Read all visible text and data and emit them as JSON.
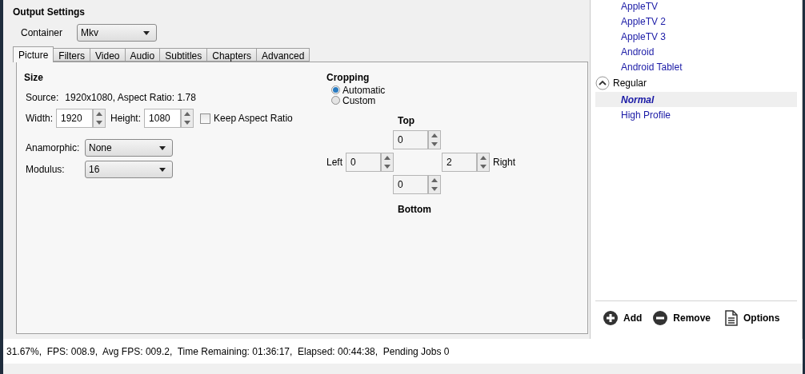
{
  "output_settings": {
    "title": "Output Settings",
    "container_label": "Container",
    "container_value": "Mkv"
  },
  "tabs": [
    {
      "label": "Picture",
      "selected": true
    },
    {
      "label": "Filters",
      "selected": false
    },
    {
      "label": "Video",
      "selected": false
    },
    {
      "label": "Audio",
      "selected": false
    },
    {
      "label": "Subtitles",
      "selected": false
    },
    {
      "label": "Chapters",
      "selected": false
    },
    {
      "label": "Advanced",
      "selected": false
    }
  ],
  "size": {
    "title": "Size",
    "source_label": "Source:",
    "source_value": "1920x1080, Aspect Ratio: 1.78",
    "width_label": "Width:",
    "width_value": "1920",
    "height_label": "Height:",
    "height_value": "1080",
    "keep_aspect": {
      "label": "Keep Aspect Ratio",
      "checked": false
    },
    "anamorphic_label": "Anamorphic:",
    "anamorphic_value": "None",
    "modulus_label": "Modulus:",
    "modulus_value": "16"
  },
  "cropping": {
    "title": "Cropping",
    "modes": [
      {
        "label": "Automatic",
        "selected": true
      },
      {
        "label": "Custom",
        "selected": false
      }
    ],
    "top_label": "Top",
    "top_value": "0",
    "left_label": "Left",
    "left_value": "0",
    "right_value": "2",
    "right_label": "Right",
    "bottom_value": "0",
    "bottom_label": "Bottom"
  },
  "presets": [
    {
      "kind": "preset",
      "label": "AppleTV",
      "selected": false
    },
    {
      "kind": "preset",
      "label": "AppleTV 2",
      "selected": false
    },
    {
      "kind": "preset",
      "label": "AppleTV 3",
      "selected": false
    },
    {
      "kind": "preset",
      "label": "Android",
      "selected": false
    },
    {
      "kind": "preset",
      "label": "Android Tablet",
      "selected": false
    },
    {
      "kind": "group",
      "label": "Regular",
      "expanded": true,
      "children": [
        {
          "label": "Normal",
          "selected": true
        },
        {
          "label": "High Profile",
          "selected": false
        }
      ]
    }
  ],
  "preset_buttons": [
    {
      "kind": "add",
      "label": "Add"
    },
    {
      "kind": "remove",
      "label": "Remove"
    },
    {
      "kind": "options",
      "label": "Options"
    }
  ],
  "status_bar": "31.67%,  FPS: 008.9,  Avg FPS: 009.2,  Time Remaining: 01:36:17,  Elapsed: 00:44:38,  Pending Jobs 0"
}
